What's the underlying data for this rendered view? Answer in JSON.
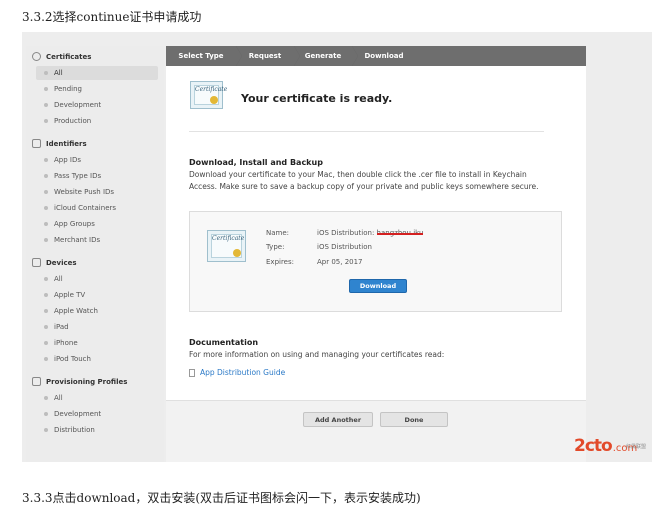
{
  "headings": {
    "top": "3.3.2选择continue证书申请成功",
    "bottom": "3.3.3点击download，双击安装(双击后证书图标会闪一下，表示安装成功)"
  },
  "sidebar": {
    "sections": [
      {
        "title": "Certificates",
        "items": [
          "All",
          "Pending",
          "Development",
          "Production"
        ],
        "selected": "All"
      },
      {
        "title": "Identifiers",
        "items": [
          "App IDs",
          "Pass Type IDs",
          "Website Push IDs",
          "iCloud Containers",
          "App Groups",
          "Merchant IDs"
        ]
      },
      {
        "title": "Devices",
        "items": [
          "All",
          "Apple TV",
          "Apple Watch",
          "iPad",
          "iPhone",
          "iPod Touch"
        ]
      },
      {
        "title": "Provisioning Profiles",
        "items": [
          "All",
          "Development",
          "Distribution"
        ]
      }
    ]
  },
  "steps": [
    "Select Type",
    "Request",
    "Generate",
    "Download"
  ],
  "main": {
    "ready_title": "Your certificate is ready.",
    "certificate_script": "Certificate",
    "download_heading": "Download, Install and Backup",
    "download_text_1": "Download your certificate to your Mac, then double click the .cer file to install in Keychain",
    "download_text_2": "Access. Make sure to save a backup copy of your private and public keys somewhere secure.",
    "details": {
      "name_label": "Name:",
      "name_value": "iOS Distribution: ",
      "name_redacted": "hangzhou iku",
      "type_label": "Type:",
      "type_value": "iOS Distribution",
      "expires_label": "Expires:",
      "expires_value": "Apr 05, 2017"
    },
    "download_button": "Download",
    "documentation_heading": "Documentation",
    "documentation_text": "For more information on using and managing your certificates read:",
    "doc_link": "App Distribution Guide"
  },
  "footer": {
    "add_another": "Add Another",
    "done": "Done"
  },
  "watermark": {
    "main": "2cto",
    "suffix": ".com",
    "small": "红黑联盟"
  },
  "colors": {
    "accent_blue": "#2f84cf",
    "step_bar": "#6e6e6e",
    "watermark": "#e24a2a"
  }
}
